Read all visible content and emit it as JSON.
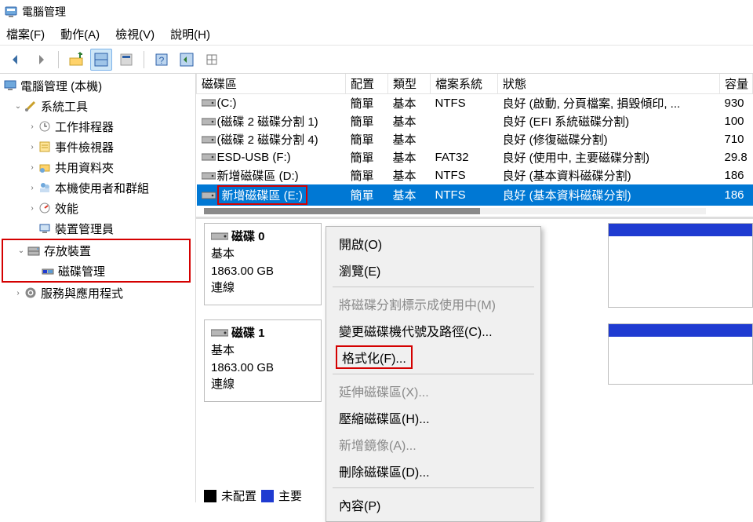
{
  "window": {
    "title": "電腦管理"
  },
  "menubar": {
    "file": "檔案(F)",
    "action": "動作(A)",
    "view": "檢視(V)",
    "help": "說明(H)"
  },
  "tree": {
    "root": "電腦管理 (本機)",
    "systools": "系統工具",
    "task_scheduler": "工作排程器",
    "event_viewer": "事件檢視器",
    "shared_folders": "共用資料夾",
    "users_groups": "本機使用者和群組",
    "performance": "效能",
    "device_manager": "裝置管理員",
    "storage": "存放裝置",
    "disk_mgmt": "磁碟管理",
    "services": "服務與應用程式"
  },
  "columns": {
    "vol": "磁碟區",
    "layout": "配置",
    "type": "類型",
    "fs": "檔案系統",
    "status": "狀態",
    "cap": "容量"
  },
  "rows": [
    {
      "name": "(C:)",
      "layout": "簡單",
      "type": "基本",
      "fs": "NTFS",
      "status": "良好 (啟動, 分頁檔案, 損毀傾印, ...",
      "cap": "930"
    },
    {
      "name": "(磁碟 2 磁碟分割 1)",
      "layout": "簡單",
      "type": "基本",
      "fs": "",
      "status": "良好 (EFI 系統磁碟分割)",
      "cap": "100"
    },
    {
      "name": "(磁碟 2 磁碟分割 4)",
      "layout": "簡單",
      "type": "基本",
      "fs": "",
      "status": "良好 (修復磁碟分割)",
      "cap": "710"
    },
    {
      "name": "ESD-USB (F:)",
      "layout": "簡單",
      "type": "基本",
      "fs": "FAT32",
      "status": "良好 (使用中, 主要磁碟分割)",
      "cap": "29.8"
    },
    {
      "name": "新增磁碟區 (D:)",
      "layout": "簡單",
      "type": "基本",
      "fs": "NTFS",
      "status": "良好 (基本資料磁碟分割)",
      "cap": "186"
    },
    {
      "name": "新增磁碟區 (E:)",
      "layout": "簡單",
      "type": "基本",
      "fs": "NTFS",
      "status": "良好 (基本資料磁碟分割)",
      "cap": "186"
    }
  ],
  "disks": [
    {
      "title": "磁碟 0",
      "type": "基本",
      "size": "1863.00 GB",
      "status": "連線"
    },
    {
      "title": "磁碟 1",
      "type": "基本",
      "size": "1863.00 GB",
      "status": "連線"
    }
  ],
  "legend": {
    "unalloc": "未配置",
    "primary": "主要"
  },
  "menu": {
    "open": "開啟(O)",
    "browse": "瀏覽(E)",
    "mark": "將磁碟分割標示成使用中(M)",
    "change": "變更磁碟機代號及路徑(C)...",
    "format": "格式化(F)...",
    "extend": "延伸磁碟區(X)...",
    "shrink": "壓縮磁碟區(H)...",
    "mirror": "新增鏡像(A)...",
    "delete": "刪除磁碟區(D)...",
    "props": "內容(P)"
  },
  "colors": {
    "sel": "#0078d4",
    "highlight": "#d40000",
    "unalloc": "#000",
    "primary": "#1f3bd1"
  }
}
